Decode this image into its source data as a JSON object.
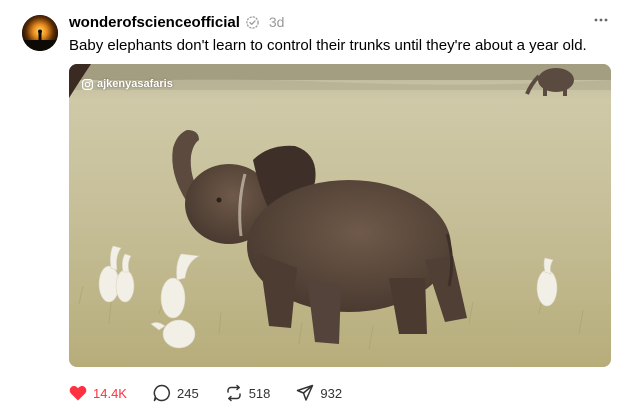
{
  "post": {
    "username": "wonderofscienceofficial",
    "time": "3d",
    "caption": "Baby elephants don't learn to control their trunks until they're about a year old.",
    "media": {
      "watermark": "ajkenyasafaris"
    },
    "actions": {
      "likes": "14.4K",
      "comments": "245",
      "reposts": "518",
      "shares": "932"
    },
    "colors": {
      "like_red": "#ff3040",
      "muted": "#999999"
    },
    "icons": [
      "verified-icon",
      "more-icon",
      "instagram-icon",
      "heart-icon",
      "comment-icon",
      "repost-icon",
      "share-icon"
    ]
  }
}
